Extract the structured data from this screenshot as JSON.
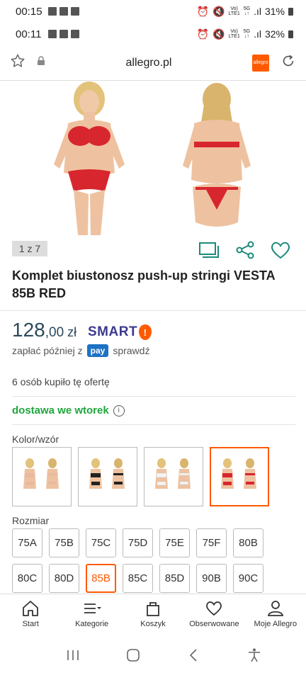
{
  "status_bars": [
    {
      "time": "00:15",
      "battery": "31%"
    },
    {
      "time": "00:11",
      "battery": "32%"
    }
  ],
  "browser": {
    "url": "allegro.pl",
    "icons": [
      "star-icon",
      "lock-icon",
      "allegro-app-icon",
      "reload-icon"
    ],
    "logo_text": "allegro"
  },
  "gallery": {
    "counter": "1 z 7",
    "actions": [
      "gallery-view-icon",
      "share-icon",
      "heart-icon"
    ]
  },
  "product": {
    "title": "Komplet biustonosz push-up stringi VESTA 85B RED",
    "price_int": "128",
    "price_cents": ",00",
    "currency": "zł",
    "smart_label": "SMART",
    "smart_mark": "!",
    "pay_later_prefix": "zapłać później z",
    "pay_badge": "pay",
    "pay_later_suffix": "sprawdź",
    "sold_info": "6 osób kupiło tę ofertę",
    "delivery": "dostawa we wtorek",
    "info_mark": "i"
  },
  "color_section": {
    "label": "Kolor/wzór",
    "variants": [
      {
        "color": "#e8b9a0"
      },
      {
        "color": "#222222"
      },
      {
        "color": "#f4f4f4"
      },
      {
        "color": "#d8262e",
        "selected": true
      }
    ]
  },
  "size_section": {
    "label": "Rozmiar",
    "row1": [
      "75A",
      "75B",
      "75C",
      "75D",
      "75E",
      "75F",
      "80B"
    ],
    "row2": [
      "80C",
      "80D",
      "85B",
      "85C",
      "85D",
      "90B",
      "90C"
    ],
    "selected": "85B"
  },
  "bottom_nav": [
    {
      "label": "Start",
      "icon": "home-icon"
    },
    {
      "label": "Kategorie",
      "icon": "menu-icon"
    },
    {
      "label": "Koszyk",
      "icon": "bag-icon"
    },
    {
      "label": "Obserwowane",
      "icon": "heart-icon"
    },
    {
      "label": "Moje Allegro",
      "icon": "user-icon"
    }
  ],
  "colors": {
    "accent": "#ff5a00",
    "price": "#2b4a5a",
    "delivery": "#1ea53d",
    "action_icons": "#1a8a7a",
    "smart": "#3d3a8f"
  }
}
